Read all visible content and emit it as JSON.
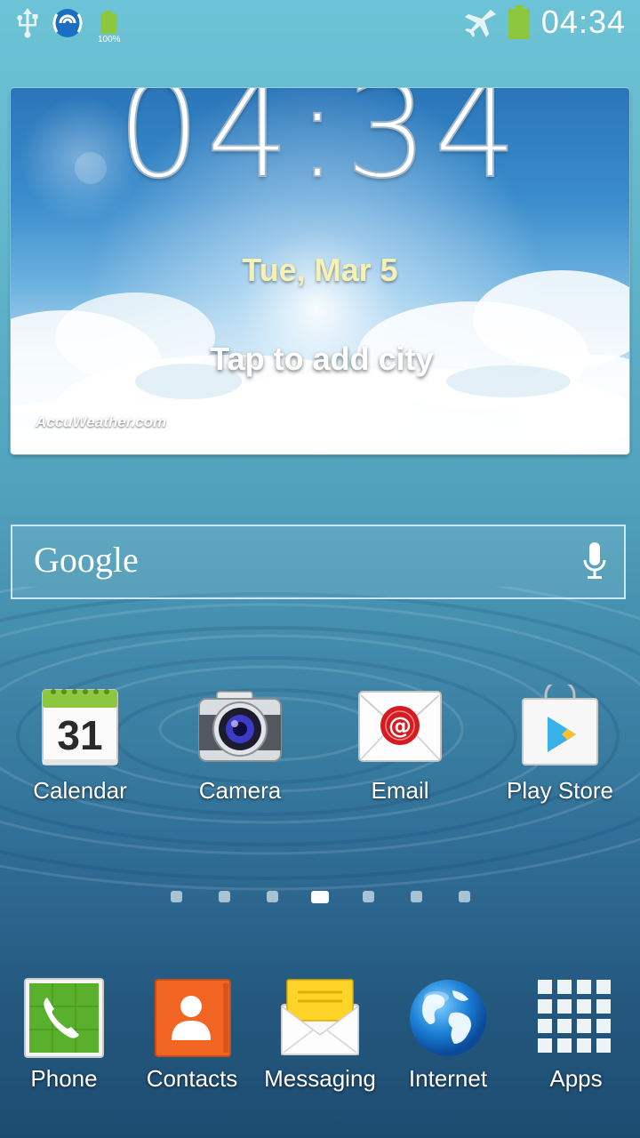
{
  "status_bar": {
    "time": "04:34",
    "battery_percent_label": "100%",
    "icons": [
      "usb-icon",
      "wifi-signal-icon",
      "battery-small-icon",
      "airplane-mode-icon",
      "battery-icon"
    ]
  },
  "clock_widget": {
    "time": "04:34",
    "date": "Tue, Mar 5",
    "city_prompt": "Tap to add city",
    "brand": "AccuWeather.com"
  },
  "search": {
    "logo_text": "Google",
    "mic_icon": "microphone-icon"
  },
  "home_apps": [
    {
      "label": "Calendar",
      "icon": "calendar-icon",
      "calendar_day": "31"
    },
    {
      "label": "Camera",
      "icon": "camera-icon"
    },
    {
      "label": "Email",
      "icon": "email-icon"
    },
    {
      "label": "Play Store",
      "icon": "play-store-icon"
    }
  ],
  "page_indicator": {
    "total_pages": 7,
    "current_page": 4
  },
  "dock": [
    {
      "label": "Phone",
      "icon": "phone-icon"
    },
    {
      "label": "Contacts",
      "icon": "contacts-icon"
    },
    {
      "label": "Messaging",
      "icon": "messaging-icon"
    },
    {
      "label": "Internet",
      "icon": "internet-globe-icon"
    },
    {
      "label": "Apps",
      "icon": "apps-grid-icon"
    }
  ],
  "colors": {
    "status_battery": "#8dc63f",
    "date_text": "#f6f1b5",
    "calendar_green": "#8dc63f",
    "contacts_orange": "#f26522",
    "phone_green": "#5fb830"
  }
}
